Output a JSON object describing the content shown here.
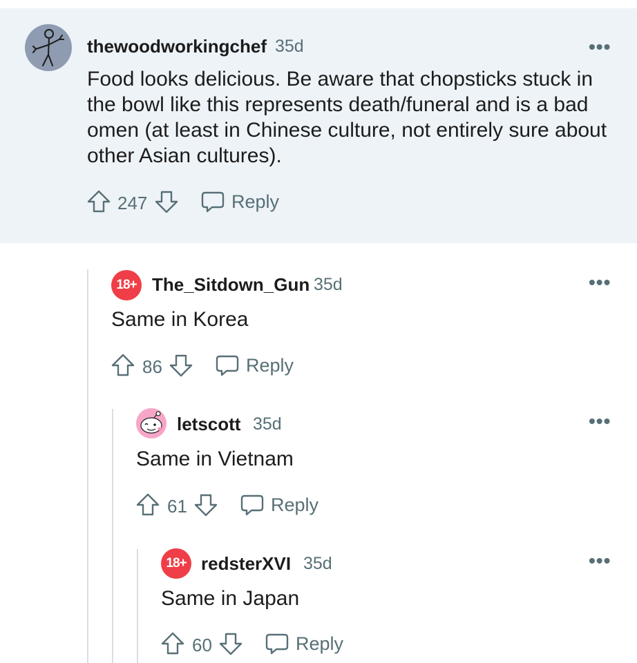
{
  "comments": [
    {
      "username": "thewoodworkingchef",
      "age": "35d",
      "avatar": "stick-figure-avatar",
      "body": "Food looks delicious. Be aware that chopsticks stuck in the bowl like this represents death/funeral and is a bad omen (at least in Chinese culture, not entirely sure about other Asian cultures).",
      "votes": "247",
      "reply_label": "Reply",
      "more": "•••",
      "highlighted": true
    },
    {
      "username": "The_Sitdown_Gun",
      "age": "35d",
      "avatar": "nsfw-18-avatar",
      "avatar_text": "18+",
      "body": "Same in Korea",
      "votes": "86",
      "reply_label": "Reply",
      "more": "•••"
    },
    {
      "username": "letscott",
      "age": "35d",
      "avatar": "snoo-avatar",
      "body": "Same in Vietnam",
      "votes": "61",
      "reply_label": "Reply",
      "more": "•••"
    },
    {
      "username": "redsterXVI",
      "age": "35d",
      "avatar": "nsfw-18-avatar",
      "avatar_text": "18+",
      "body": "Same in Japan",
      "votes": "60",
      "reply_label": "Reply",
      "more": "•••"
    }
  ],
  "colors": {
    "highlight_bg": "#eef3f8",
    "nsfw_badge": "#ef3e47",
    "meta_text": "#576f76",
    "thread_line": "#d9dde1"
  }
}
